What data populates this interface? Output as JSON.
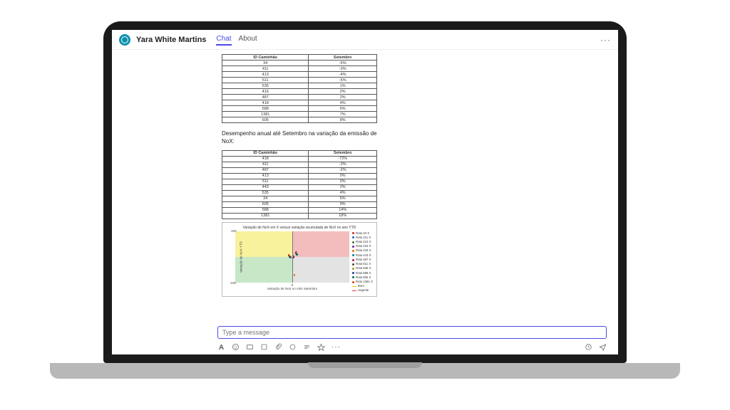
{
  "header": {
    "bot_name": "Yara White Martins",
    "tabs": [
      {
        "label": "Chat",
        "active": true
      },
      {
        "label": "About",
        "active": false
      }
    ],
    "more": "···"
  },
  "card": {
    "table1": {
      "headers": [
        "ID Caminhão",
        "Setembro"
      ],
      "rows": [
        [
          "34",
          "-6%"
        ],
        [
          "411",
          "-3%"
        ],
        [
          "413",
          "-4%"
        ],
        [
          "511",
          "-5%"
        ],
        [
          "535",
          "1%"
        ],
        [
          "416",
          "2%"
        ],
        [
          "487",
          "2%"
        ],
        [
          "418",
          "4%"
        ],
        [
          "588",
          "6%"
        ],
        [
          "1381",
          "7%"
        ],
        [
          "605",
          "8%"
        ]
      ]
    },
    "section_title": "Desempenho anual até Setembro na variação da emissão de NoX:",
    "table2": {
      "headers": [
        "ID Caminhão",
        "Setembro"
      ],
      "rows": [
        [
          "418",
          "-72%"
        ],
        [
          "411",
          "-3%"
        ],
        [
          "487",
          "-2%"
        ],
        [
          "413",
          "0%"
        ],
        [
          "511",
          "0%"
        ],
        [
          "443",
          "2%"
        ],
        [
          "535",
          "4%"
        ],
        [
          "34",
          "6%"
        ],
        [
          "605",
          "9%"
        ],
        [
          "588",
          "14%"
        ],
        [
          "1381",
          "18%"
        ]
      ]
    }
  },
  "chart_data": {
    "type": "scatter",
    "title": "Variação de NoX em X versus variação acumulada de NoX no ano YTD",
    "xlabel": "Variação de NoX no mês Setembro",
    "ylabel": "Variação de NoX YTD",
    "xlim": [
      -100,
      100
    ],
    "ylim": [
      -100,
      100
    ],
    "series": [
      {
        "name": "Rota 34 X",
        "color": "#c62828",
        "x": -6,
        "y": 6
      },
      {
        "name": "Rota 411 X",
        "color": "#1565c0",
        "x": -3,
        "y": -3
      },
      {
        "name": "Rota 413 X",
        "color": "#2e7d32",
        "x": -4,
        "y": 0
      },
      {
        "name": "Rota 416 X",
        "color": "#6a1b9a",
        "x": 2,
        "y": 1
      },
      {
        "name": "Rota 418 X",
        "color": "#ef6c00",
        "x": 4,
        "y": -72
      },
      {
        "name": "Rota 443 X",
        "color": "#00838f",
        "x": 2,
        "y": 2
      },
      {
        "name": "Rota 487 X",
        "color": "#ad1457",
        "x": 2,
        "y": -2
      },
      {
        "name": "Rota 511 X",
        "color": "#5d4037",
        "x": -5,
        "y": 0
      },
      {
        "name": "Rota 535 X",
        "color": "#9e9d24",
        "x": 1,
        "y": 4
      },
      {
        "name": "Rota 588 X",
        "color": "#283593",
        "x": 6,
        "y": 14
      },
      {
        "name": "Rota 605 X",
        "color": "#00695c",
        "x": 8,
        "y": 9
      },
      {
        "name": "Rota 1381 X",
        "color": "#d84315",
        "x": 7,
        "y": 18
      }
    ],
    "guides": [
      {
        "name": "Bom",
        "color": "#f2c200"
      },
      {
        "name": "Urgente",
        "color": "#e53935"
      }
    ],
    "tick_top": "100",
    "tick_bottom": "-100",
    "tick_mid": "0"
  },
  "composer": {
    "placeholder": "Type a message",
    "more": "···"
  }
}
